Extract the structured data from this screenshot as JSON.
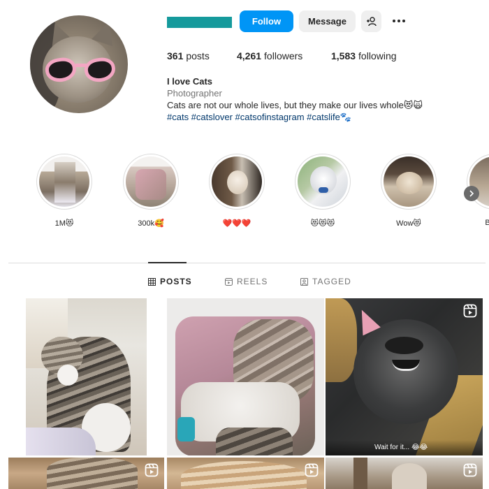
{
  "profile": {
    "follow_label": "Follow",
    "message_label": "Message",
    "posts_count": "361",
    "posts_label": "posts",
    "followers_count": "4,261",
    "followers_label": "followers",
    "following_count": "1,583",
    "following_label": "following",
    "name": "I love Cats",
    "category": "Photographer",
    "bio": "Cats are not our whole lives, but they make our lives whole😻🙀",
    "hashtags": "#cats #catslover #catsofinstagram #catslife🐾"
  },
  "highlights": [
    {
      "label": "1M😻"
    },
    {
      "label": "300k🥰"
    },
    {
      "label": "❤️❤️❤️"
    },
    {
      "label": "😻😻😻"
    },
    {
      "label": "Wow😻"
    },
    {
      "label": "B"
    }
  ],
  "tabs": [
    {
      "label": "POSTS",
      "icon": "grid-icon",
      "active": true
    },
    {
      "label": "REELS",
      "icon": "reels-icon",
      "active": false
    },
    {
      "label": "TAGGED",
      "icon": "tagged-icon",
      "active": false
    }
  ],
  "posts": [
    {
      "type": "image"
    },
    {
      "type": "image"
    },
    {
      "type": "reel",
      "caption": "Wait for it... 😂😂"
    },
    {
      "type": "reel"
    },
    {
      "type": "reel"
    },
    {
      "type": "reel"
    }
  ],
  "colors": {
    "accent": "#0095f6",
    "username_bar": "#159a9c",
    "link": "#00376b"
  }
}
